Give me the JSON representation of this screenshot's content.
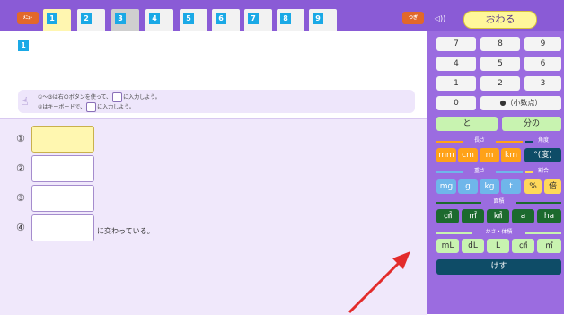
{
  "header": {
    "menu_label": "ﾒﾆｭｰ",
    "tabs": [
      "1",
      "2",
      "3",
      "4",
      "5",
      "6",
      "7",
      "8",
      "9"
    ],
    "next_label": "つぎ",
    "speaker_label": "◁))",
    "end_label": "おわる"
  },
  "question": {
    "badge": "1",
    "hint_line1": "①〜③は右のボタンを使って、",
    "hint_line1_tail": "に入力しよう。",
    "hint_line2": "④はキーボードで、",
    "hint_line2_tail": "に入力しよう。"
  },
  "answers": {
    "labels": [
      "①",
      "②",
      "③",
      "④"
    ],
    "suffix": "に交わっている。"
  },
  "keypad": {
    "nums": [
      "7",
      "8",
      "9",
      "4",
      "5",
      "6",
      "1",
      "2",
      "3",
      "0",
      "●（小数点）"
    ],
    "to": "と",
    "bunno": "分の",
    "length_title": "長さ",
    "angle_title": "角度",
    "length_units": [
      "mm",
      "cm",
      "m",
      "km"
    ],
    "angle_unit": "°(度)",
    "weight_title": "重さ",
    "ratio_title": "割合",
    "weight_units": [
      "mg",
      "g",
      "kg",
      "t"
    ],
    "ratio_units": [
      "%",
      "倍"
    ],
    "area_title": "面積",
    "area_units": [
      "㎠",
      "㎡",
      "㎢",
      "a",
      "ha"
    ],
    "volume_title": "かさ・体積",
    "volume_units": [
      "mL",
      "dL",
      "L",
      "㎤",
      "㎥"
    ],
    "erase": "けす"
  },
  "colors": {
    "accent": "#8a5bd6",
    "pad": "#9b6ce0",
    "arrow": "#e32b2b"
  }
}
